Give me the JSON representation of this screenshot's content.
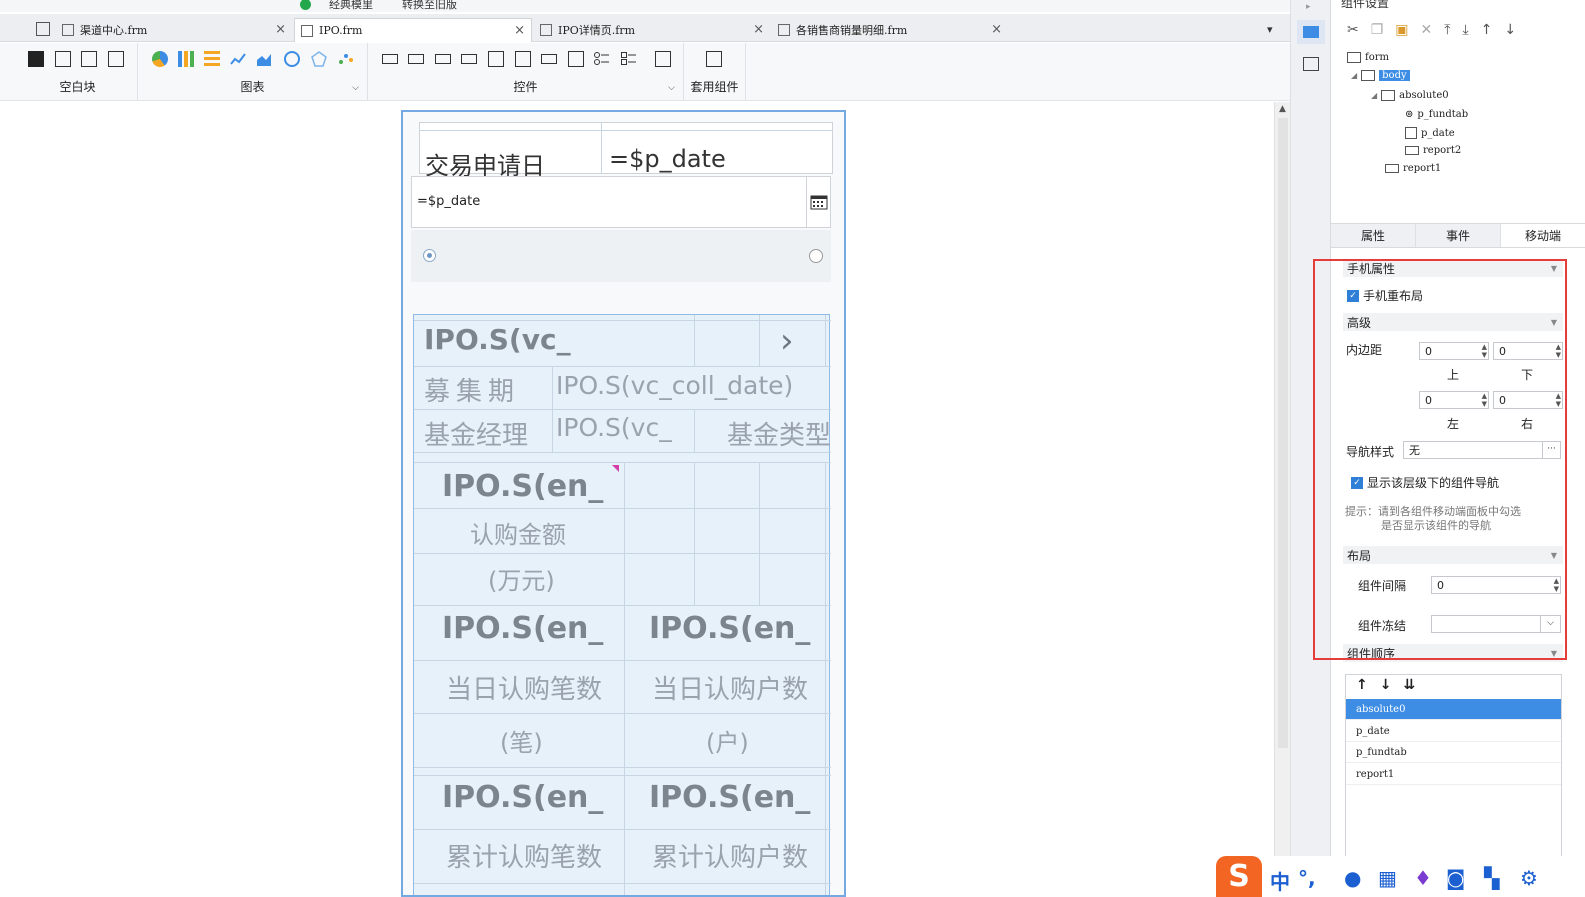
{
  "topbar": {
    "items": [
      "经典模里",
      "转换至旧版"
    ]
  },
  "tabs": [
    {
      "label": "渠道中心.frm"
    },
    {
      "label": "IPO.frm"
    },
    {
      "label": "IPO详情页.frm"
    },
    {
      "label": "各销售商销量明细.frm"
    }
  ],
  "ribbon": {
    "groups": [
      {
        "label": "空白块"
      },
      {
        "label": "图表"
      },
      {
        "label": "控件"
      },
      {
        "label": "套用组件"
      }
    ]
  },
  "report": {
    "label": "交易申请日",
    "value": "=$p_date"
  },
  "date_input": {
    "value": "=$p_date"
  },
  "fundtab": {
    "title": "IPO.S(vc_",
    "chevron": "›",
    "rows": [
      {
        "label": "募集期",
        "value": "IPO.S(vc_coll_date)"
      },
      {
        "label": "基金经理",
        "value": "IPO.S(vc_",
        "label2": "基金类型"
      }
    ],
    "blocks": [
      {
        "value": "IPO.S(en_",
        "label": "认购金额",
        "unit": "(万元)"
      },
      {
        "value": "IPO.S(en_",
        "label": "当日认购笔数",
        "unit": "(笔)"
      },
      {
        "value": "IPO.S(en_",
        "label": "当日认购户数",
        "unit": "(户)"
      },
      {
        "value": "IPO.S(en_",
        "label": "累计认购笔数"
      },
      {
        "value": "IPO.S(en_",
        "label": "累计认购户数"
      }
    ]
  },
  "panel": {
    "title": "组件设置",
    "tree": [
      {
        "label": "form"
      },
      {
        "label": "body"
      },
      {
        "label": "absolute0"
      },
      {
        "label": "p_fundtab"
      },
      {
        "label": "p_date"
      },
      {
        "label": "report2"
      },
      {
        "label": "report1"
      }
    ],
    "tabs": [
      "属性",
      "事件",
      "移动端"
    ],
    "mobile": {
      "section_phone": "手机属性",
      "relayout": "手机重布局",
      "section_adv": "高级",
      "padding_label": "内边距",
      "padding": {
        "top": "0",
        "bottom": "0",
        "left": "0",
        "right": "0"
      },
      "padding_sides": {
        "top": "上",
        "bottom": "下",
        "left": "左",
        "right": "右"
      },
      "nav_style_label": "导航样式",
      "nav_style_value": "无",
      "nav_more": "···",
      "show_nav": "显示该层级下的组件导航",
      "hint_line1": "提示：请到各组件移动端面板中勾选",
      "hint_line2": "是否显示该组件的导航",
      "section_layout": "布局",
      "gap_label": "组件间隔",
      "gap_value": "0",
      "freeze_label": "组件冻结",
      "freeze_value": "",
      "section_order": "组件顺序"
    },
    "order": [
      "absolute0",
      "p_date",
      "p_fundtab",
      "report1"
    ]
  },
  "ime": {
    "mode": "中",
    "punct": "°,"
  },
  "colors": {
    "accent": "#3d8de4",
    "highlight": "#e53c3c",
    "phone_border": "#74a9e1"
  }
}
